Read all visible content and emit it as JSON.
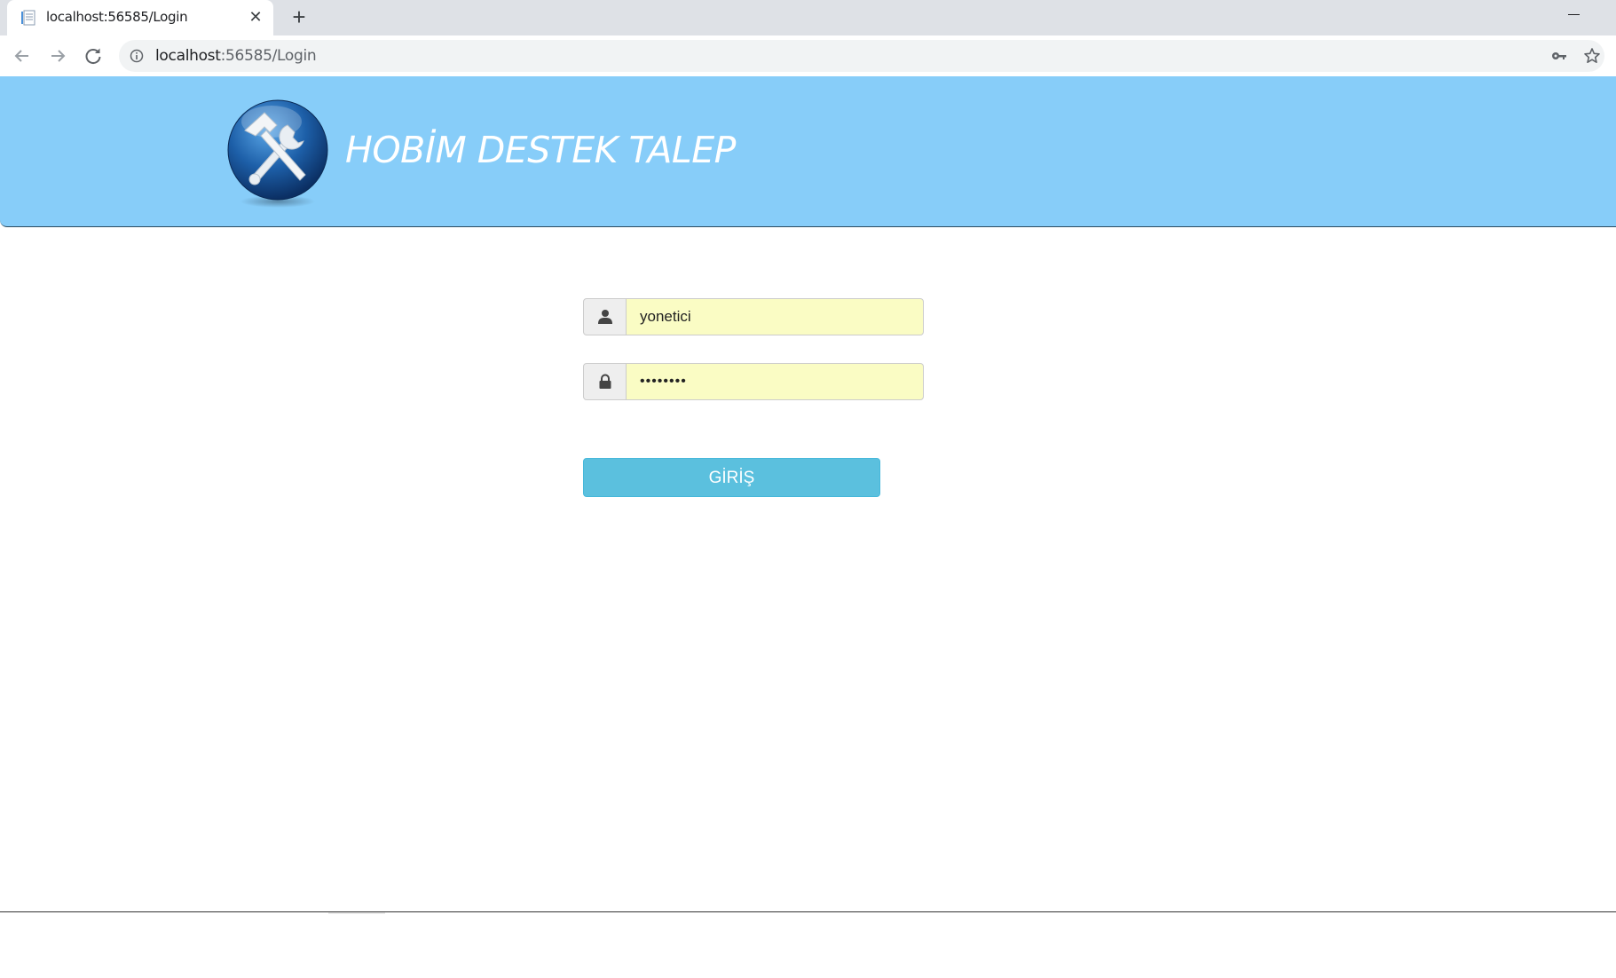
{
  "browser": {
    "tab_title": "localhost:56585/Login",
    "close_symbol": "✕",
    "new_tab_symbol": "+",
    "url_host": "localhost",
    "url_rest": ":56585/Login",
    "icons": [
      "page-favicon-icon",
      "close-icon",
      "plus-icon",
      "minimize-icon",
      "back-icon",
      "forward-icon",
      "reload-icon",
      "info-icon",
      "key-icon",
      "star-icon"
    ]
  },
  "header": {
    "title": "HOBİM DESTEK TALEP",
    "background_color": "#87cdf9",
    "logo_icon": "tools-globe-icon"
  },
  "login": {
    "username_value": "yonetici",
    "password_value": "********",
    "username_icon": "user-icon",
    "password_icon": "lock-icon",
    "field_background": "#fafcc4",
    "submit_label": "GİRİŞ",
    "submit_color": "#5bc0de"
  }
}
